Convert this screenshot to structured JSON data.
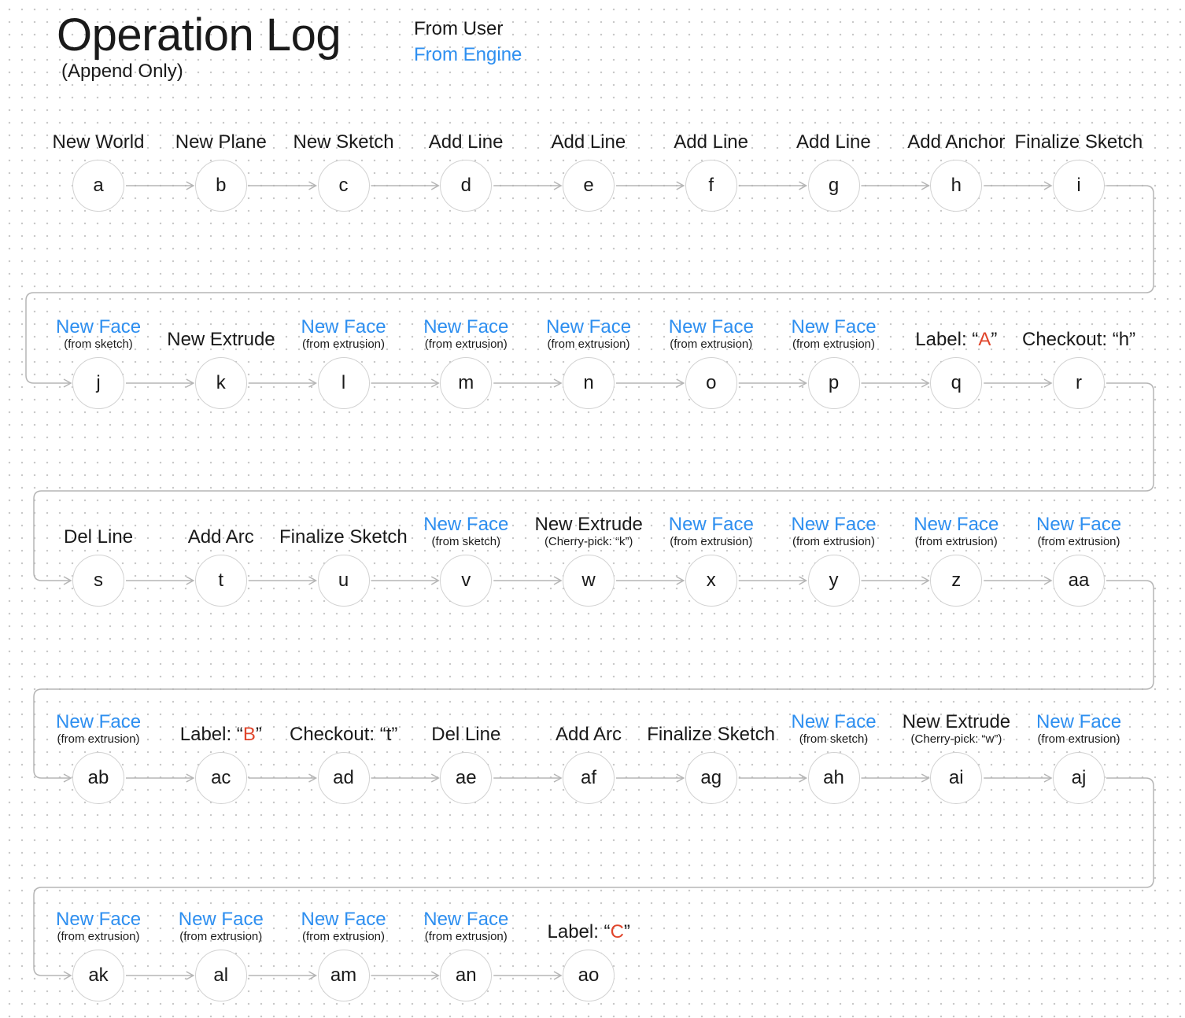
{
  "header": {
    "title": "Operation Log",
    "subtitle": "(Append Only)",
    "legend_user": "From User",
    "legend_engine": "From Engine"
  },
  "colors": {
    "engine": "#2e8ff0",
    "user": "#1a1a1a",
    "highlight": "#e0452b",
    "connector": "#b5b5b5",
    "node_border": "#d2d2d2"
  },
  "rows": [
    [
      {
        "id": "a",
        "label": "New World",
        "source": "user"
      },
      {
        "id": "b",
        "label": "New Plane",
        "source": "user"
      },
      {
        "id": "c",
        "label": "New Sketch",
        "source": "user"
      },
      {
        "id": "d",
        "label": "Add Line",
        "source": "user"
      },
      {
        "id": "e",
        "label": "Add Line",
        "source": "user"
      },
      {
        "id": "f",
        "label": "Add Line",
        "source": "user"
      },
      {
        "id": "g",
        "label": "Add Line",
        "source": "user"
      },
      {
        "id": "h",
        "label": "Add Anchor",
        "source": "user"
      },
      {
        "id": "i",
        "label": "Finalize Sketch",
        "source": "user"
      }
    ],
    [
      {
        "id": "j",
        "label": "New Face",
        "sub": "(from sketch)",
        "source": "engine"
      },
      {
        "id": "k",
        "label": "New Extrude",
        "source": "user"
      },
      {
        "id": "l",
        "label": "New Face",
        "sub": "(from extrusion)",
        "source": "engine"
      },
      {
        "id": "m",
        "label": "New Face",
        "sub": "(from extrusion)",
        "source": "engine"
      },
      {
        "id": "n",
        "label": "New Face",
        "sub": "(from extrusion)",
        "source": "engine"
      },
      {
        "id": "o",
        "label": "New Face",
        "sub": "(from extrusion)",
        "source": "engine"
      },
      {
        "id": "p",
        "label": "New Face",
        "sub": "(from extrusion)",
        "source": "engine"
      },
      {
        "id": "q",
        "label": "Label: “",
        "highlight": "A",
        "suffix": "”",
        "source": "user"
      },
      {
        "id": "r",
        "label": "Checkout: “h”",
        "source": "user"
      }
    ],
    [
      {
        "id": "s",
        "label": "Del Line",
        "source": "user"
      },
      {
        "id": "t",
        "label": "Add Arc",
        "source": "user"
      },
      {
        "id": "u",
        "label": "Finalize Sketch",
        "source": "user"
      },
      {
        "id": "v",
        "label": "New Face",
        "sub": "(from sketch)",
        "source": "engine"
      },
      {
        "id": "w",
        "label": "New Extrude",
        "sub": "(Cherry-pick: “k”)",
        "source": "user"
      },
      {
        "id": "x",
        "label": "New Face",
        "sub": "(from extrusion)",
        "source": "engine"
      },
      {
        "id": "y",
        "label": "New Face",
        "sub": "(from extrusion)",
        "source": "engine"
      },
      {
        "id": "z",
        "label": "New Face",
        "sub": "(from extrusion)",
        "source": "engine"
      },
      {
        "id": "aa",
        "label": "New Face",
        "sub": "(from extrusion)",
        "source": "engine"
      }
    ],
    [
      {
        "id": "ab",
        "label": "New Face",
        "sub": "(from extrusion)",
        "source": "engine"
      },
      {
        "id": "ac",
        "label": "Label: “",
        "highlight": "B",
        "suffix": "”",
        "source": "user"
      },
      {
        "id": "ad",
        "label": "Checkout: “t”",
        "source": "user"
      },
      {
        "id": "ae",
        "label": "Del Line",
        "source": "user"
      },
      {
        "id": "af",
        "label": "Add Arc",
        "source": "user"
      },
      {
        "id": "ag",
        "label": "Finalize Sketch",
        "source": "user"
      },
      {
        "id": "ah",
        "label": "New Face",
        "sub": "(from sketch)",
        "source": "engine"
      },
      {
        "id": "ai",
        "label": "New Extrude",
        "sub": "(Cherry-pick: “w”)",
        "source": "user"
      },
      {
        "id": "aj",
        "label": "New Face",
        "sub": "(from extrusion)",
        "source": "engine"
      }
    ],
    [
      {
        "id": "ak",
        "label": "New Face",
        "sub": "(from extrusion)",
        "source": "engine"
      },
      {
        "id": "al",
        "label": "New Face",
        "sub": "(from extrusion)",
        "source": "engine"
      },
      {
        "id": "am",
        "label": "New Face",
        "sub": "(from extrusion)",
        "source": "engine"
      },
      {
        "id": "an",
        "label": "New Face",
        "sub": "(from extrusion)",
        "source": "engine"
      },
      {
        "id": "ao",
        "label": "Label: “",
        "highlight": "C",
        "suffix": "”",
        "source": "user"
      }
    ]
  ]
}
